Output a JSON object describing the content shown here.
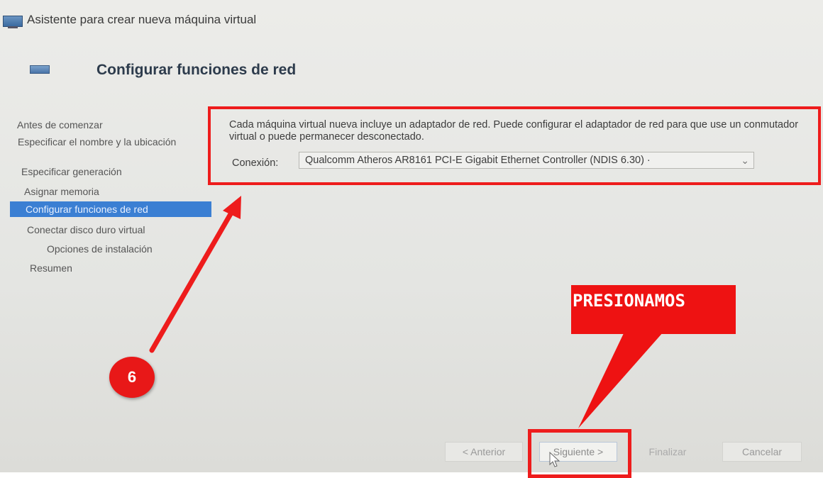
{
  "window": {
    "title": "Asistente para crear nueva máquina virtual"
  },
  "page": {
    "title": "Configurar funciones de red"
  },
  "steps": [
    {
      "label": "Antes de comenzar"
    },
    {
      "label": "Especificar el nombre y la ubicación"
    },
    {
      "label": "Especificar generación"
    },
    {
      "label": "Asignar memoria"
    },
    {
      "label": "Configurar funciones de red",
      "active": true
    },
    {
      "label": "Conectar disco duro virtual"
    },
    {
      "label": "Opciones de instalación"
    },
    {
      "label": "Resumen"
    }
  ],
  "content": {
    "description": "Cada máquina virtual nueva incluye un adaptador de red. Puede configurar el adaptador de red para que use un conmutador virtual o puede permanecer desconectado.",
    "connection_label": "Conexión:",
    "connection_value": "Qualcomm Atheros AR8161 PCI-E Gigabit Ethernet Controller (NDIS 6.30) ·"
  },
  "annotations": {
    "step_badge": "6",
    "callout": "PRESIONAMOS",
    "highlight_color": "#ee1c1c"
  },
  "buttons": {
    "back": "< Anterior",
    "next": "Siguiente >",
    "finish": "Finalizar",
    "cancel": "Cancelar"
  },
  "icons": {
    "window": "hyperv-monitor-icon",
    "dropdown": "chevron-down-icon",
    "cursor": "mouse-pointer-icon"
  }
}
